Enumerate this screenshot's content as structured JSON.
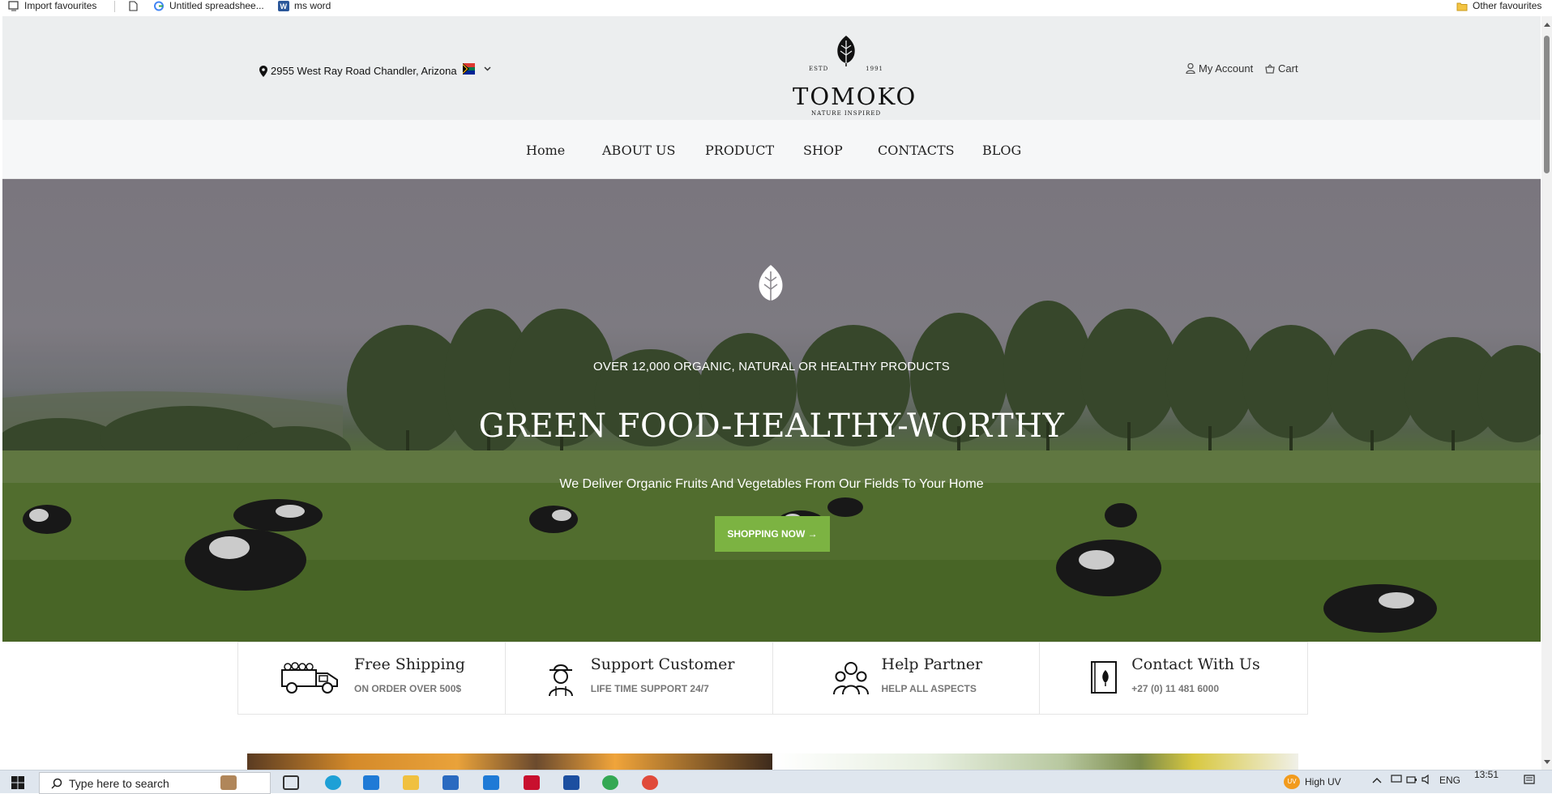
{
  "bookmarks": [
    {
      "label": "Import favourites",
      "icon": "import-icon"
    },
    {
      "label": "Untitled spreadshee...",
      "icon": "google-icon"
    },
    {
      "label": "ms word",
      "icon": "word-icon"
    }
  ],
  "other_favourites": "Other favourites",
  "header": {
    "address": "2955 West Ray Road Chandler, Arizona",
    "logo": {
      "estd": "ESTD",
      "year": "1991",
      "name": "TOMOKO",
      "tagline": "NATURE INSPIRED"
    },
    "account": "My Account",
    "cart": "Cart"
  },
  "nav": [
    {
      "label": "Home"
    },
    {
      "label": "ABOUT US"
    },
    {
      "label": "PRODUCT"
    },
    {
      "label": "SHOP"
    },
    {
      "label": "CONTACTS"
    },
    {
      "label": "BLOG"
    }
  ],
  "hero": {
    "eyebrow": "OVER 12,000 ORGANIC, NATURAL OR HEALTHY PRODUCTS",
    "headline": "GREEN FOOD-HEALTHY-WORTHY",
    "subtext": "We Deliver Organic Fruits And Vegetables From Our Fields To Your Home",
    "cta": "SHOPPING NOW →"
  },
  "features": [
    {
      "title": "Free Shipping",
      "subtitle": "ON ORDER OVER 500$",
      "icon": "truck-icon"
    },
    {
      "title": "Support Customer",
      "subtitle": "LIFE TIME SUPPORT 24/7",
      "icon": "farmer-icon"
    },
    {
      "title": "Help Partner",
      "subtitle": "HELP ALL ASPECTS",
      "icon": "people-icon"
    },
    {
      "title": "Contact With Us",
      "subtitle": "+27 (0) 11 481 6000",
      "icon": "book-icon"
    }
  ],
  "taskbar": {
    "search_placeholder": "Type here to search",
    "weather": "High UV",
    "weather_badge": "UV",
    "lang": "ENG",
    "time": "13:51"
  },
  "colors": {
    "accent": "#7cb342",
    "topbar": "#eceeef",
    "nav": "#f6f7f8"
  }
}
